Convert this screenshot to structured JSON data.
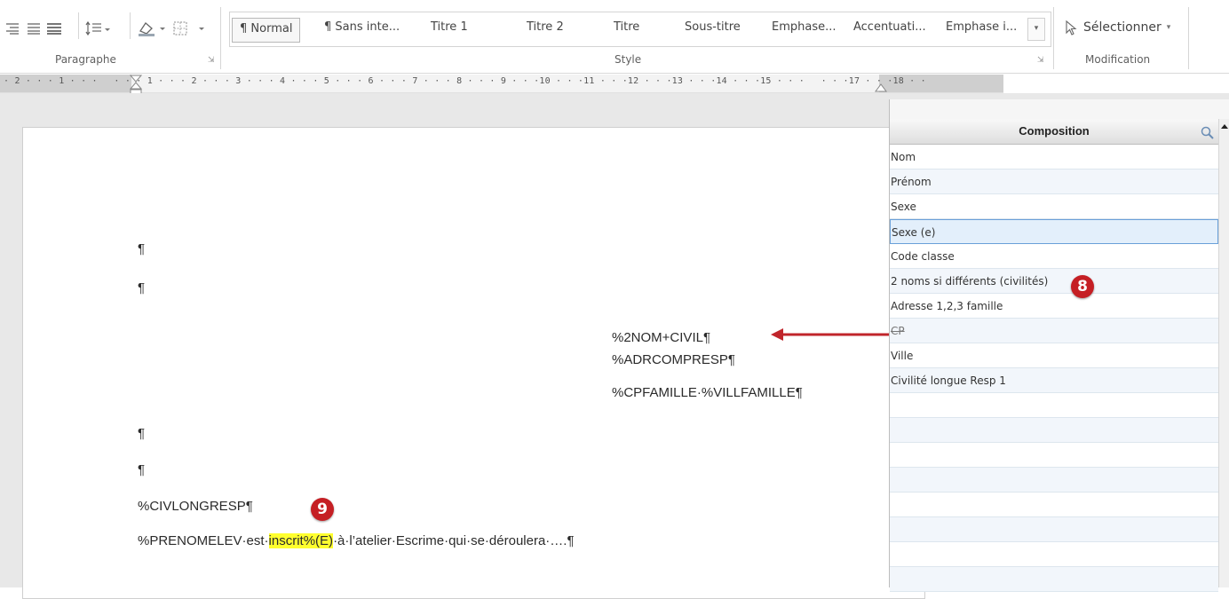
{
  "ribbon": {
    "groups": {
      "paragraph_label": "Paragraphe",
      "style_label": "Style",
      "modification_label": "Modification"
    },
    "styles": [
      "¶ Normal",
      "¶ Sans inte...",
      "Titre 1",
      "Titre 2",
      "Titre",
      "Sous-titre",
      "Emphase...",
      "Accentuati...",
      "Emphase i..."
    ],
    "select_label": "Sélectionner"
  },
  "ruler": {
    "text": "· 2 · · · 1 · · ·   · · · 1 · · · 2 · · · 3 · · · 4 · · · 5 · · · 6 · · · 7 · · · 8 · · · 9 · · ·10 · · ·11 · · ·12 · · ·13 · · ·14 · · ·15 · · ·   · · ·17 · · ·18 · ·"
  },
  "document": {
    "pilcrow": "¶",
    "addr_line1": "%2NOM+CIVIL¶",
    "addr_line2": "%ADRCOMPRESP¶",
    "addr_line3": "%CPFAMILLE·%VILLFAMILLE¶",
    "civ_line": "%CIVLONGRESP¶",
    "body_before": "%PRENOMELEV·est·",
    "body_highlight": "inscrit%(E)",
    "body_after": "·à·l’atelier·Escrime·qui·se·déroulera·….¶"
  },
  "panel": {
    "title": "Composition",
    "rows": [
      "Nom",
      "Prénom",
      "Sexe",
      "Sexe (e)",
      "Code classe",
      "2 noms si différents (civilités)",
      "Adresse 1,2,3 famille",
      "CP",
      "Ville",
      "Civilité longue Resp 1",
      "",
      "",
      "",
      "",
      "",
      "",
      "",
      ""
    ],
    "selected_index": 3
  },
  "annotations": {
    "badge_8": "8",
    "badge_9": "9"
  },
  "colors": {
    "badge": "#c51f24",
    "highlight": "#ffff2e",
    "arrow": "#c0252b",
    "selection_border": "#6aa0d9"
  }
}
